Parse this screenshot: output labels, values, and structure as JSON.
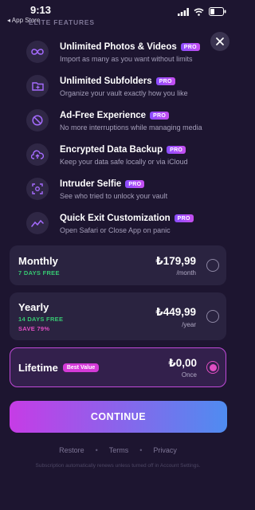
{
  "status": {
    "time": "9:13",
    "back_app": "◂ App Store"
  },
  "section_label": "ELITE FEATURES",
  "features": [
    {
      "title": "Unlimited Photos & Videos",
      "badge": "PRO",
      "desc": "Import as many as you want without limits",
      "icon": "infinity-icon"
    },
    {
      "title": "Unlimited Subfolders",
      "badge": "PRO",
      "desc": "Organize your vault exactly how you like",
      "icon": "folder-plus-icon"
    },
    {
      "title": "Ad-Free Experience",
      "badge": "PRO",
      "desc": "No more interruptions while managing media",
      "icon": "no-ads-icon"
    },
    {
      "title": "Encrypted Data Backup",
      "badge": "PRO",
      "desc": "Keep your data safe locally or via iCloud",
      "icon": "cloud-upload-icon"
    },
    {
      "title": "Intruder Selfie",
      "badge": "PRO",
      "desc": "See who tried to unlock your vault",
      "icon": "camera-scan-icon"
    },
    {
      "title": "Quick Exit Customization",
      "badge": "PRO",
      "desc": "Open Safari or Close App on panic",
      "icon": "exit-wave-icon"
    }
  ],
  "plans": [
    {
      "name": "Monthly",
      "sub1": "7 DAYS FREE",
      "price": "₺179,99",
      "period": "/month"
    },
    {
      "name": "Yearly",
      "sub1": "14 DAYS FREE",
      "sub2": "SAVE 79%",
      "price": "₺449,99",
      "period": "/year"
    },
    {
      "name": "Lifetime",
      "badge": "Best Value",
      "price": "₺0,00",
      "period": "Once"
    }
  ],
  "continue_label": "CONTINUE",
  "footer": {
    "restore": "Restore",
    "terms": "Terms",
    "privacy": "Privacy",
    "sep": "•"
  },
  "renew_note": "Subscription automatically renews unless turned off in Account Settings.",
  "colors": {
    "background": "#1d1530",
    "accent": "#e04ec2",
    "green": "#37c872",
    "gradient_start": "#c63ce6",
    "gradient_end": "#4f8cf0"
  }
}
